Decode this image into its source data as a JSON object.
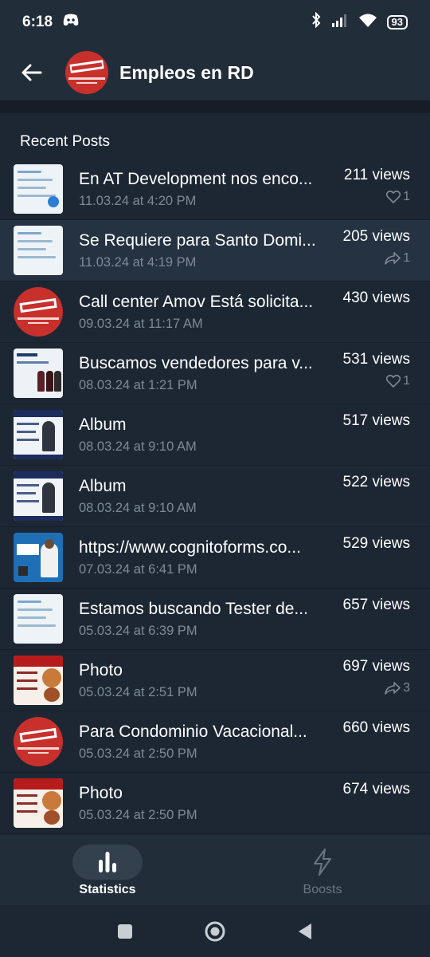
{
  "status_bar": {
    "time": "6:18",
    "battery": "93"
  },
  "header": {
    "title": "Empleos en RD"
  },
  "section_title": "Recent Posts",
  "posts": [
    {
      "title": "En AT Development nos enco...",
      "date": "11.03.24 at 4:20 PM",
      "views": "211 views",
      "reaction_type": "heart",
      "reaction_count": "1",
      "thumb": "doc"
    },
    {
      "title": "Se Requiere para Santo Domi...",
      "date": "11.03.24 at 4:19 PM",
      "views": "205 views",
      "reaction_type": "share",
      "reaction_count": "1",
      "thumb": "doc"
    },
    {
      "title": "Call center Amov Está solicita...",
      "date": "09.03.24 at 11:17 AM",
      "views": "430 views",
      "reaction_type": "",
      "reaction_count": "",
      "thumb": "circle"
    },
    {
      "title": "Buscamos vendedores para v...",
      "date": "08.03.24 at 1:21 PM",
      "views": "531 views",
      "reaction_type": "heart",
      "reaction_count": "1",
      "thumb": "wine"
    },
    {
      "title": "Album",
      "date": "08.03.24 at 9:10 AM",
      "views": "517 views",
      "reaction_type": "",
      "reaction_count": "",
      "thumb": "dark"
    },
    {
      "title": "Album",
      "date": "08.03.24 at 9:10 AM",
      "views": "522 views",
      "reaction_type": "",
      "reaction_count": "",
      "thumb": "dark"
    },
    {
      "title": "https://www.cognitoforms.co...",
      "date": "07.03.24 at 6:41 PM",
      "views": "529 views",
      "reaction_type": "",
      "reaction_count": "",
      "thumb": "blue"
    },
    {
      "title": "Estamos buscando Tester de...",
      "date": "05.03.24 at 6:39 PM",
      "views": "657 views",
      "reaction_type": "",
      "reaction_count": "",
      "thumb": "doc"
    },
    {
      "title": "Photo",
      "date": "05.03.24 at 2:51 PM",
      "views": "697 views",
      "reaction_type": "share",
      "reaction_count": "3",
      "thumb": "food"
    },
    {
      "title": "Para Condominio Vacacional...",
      "date": "05.03.24 at 2:50 PM",
      "views": "660 views",
      "reaction_type": "",
      "reaction_count": "",
      "thumb": "circle"
    },
    {
      "title": "Photo",
      "date": "05.03.24 at 2:50 PM",
      "views": "674 views",
      "reaction_type": "",
      "reaction_count": "",
      "thumb": "food"
    }
  ],
  "bottom_nav": {
    "statistics_label": "Statistics",
    "boosts_label": "Boosts"
  },
  "colors": {
    "background": "#1c2733",
    "header": "#222d3a",
    "secondary_text": "#7e8a96",
    "channel_red": "#c8302c"
  }
}
